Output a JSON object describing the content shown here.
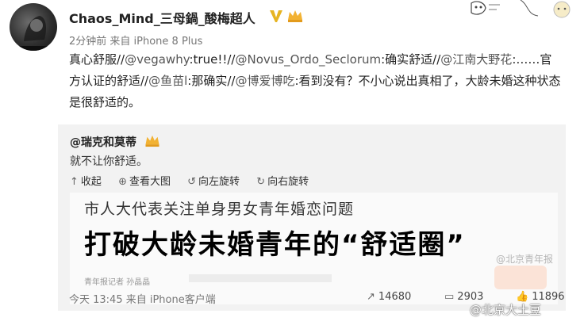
{
  "post": {
    "username": "Chaos_Mind_三母鍋_酸梅超人",
    "meta": "2分钟前 来自 iPhone 8 Plus",
    "body": {
      "t1": "真心舒服//",
      "m1": "@vegawhy",
      "t2": ":true!!//",
      "m2": "@Novus_Ordo_Seclorum",
      "t3": ":确实舒适//",
      "m3": "@江南大野花",
      "t4": ":……官方认证的舒适//",
      "m4": "@鱼苗l",
      "t5": ":那确实//",
      "m5": "@博爱博吃",
      "t6": ":看到没有？不小心说出真相了，大龄未婚这种状态是很舒适的。"
    }
  },
  "repost": {
    "author": "@瑞克和莫蒂",
    "text": "就不让你舒适。",
    "actions": [
      {
        "icon": "collapse-icon",
        "label": "收起"
      },
      {
        "icon": "zoom-icon",
        "label": "查看大图"
      },
      {
        "icon": "rotate-left-icon",
        "label": "向左旋转"
      },
      {
        "icon": "rotate-right-icon",
        "label": "向右旋转"
      }
    ],
    "image": {
      "subtitle": "市人大代表关注单身男女青年婚恋问题",
      "headline": "打破大龄未婚青年的“舒适圈”",
      "caption": "青年报记者 孙晶晶",
      "watermark": "@北京青年报"
    }
  },
  "footer": {
    "meta": "今天 13:45 来自 iPhone客户端",
    "reposts": "14680",
    "comments": "2903",
    "likes": "11896"
  },
  "watermark": "@北京大土豆",
  "colors": {
    "link": "#555555",
    "repost_bg": "#f2f2f2",
    "meta": "#777777",
    "vip_badge": "#e6b422"
  }
}
